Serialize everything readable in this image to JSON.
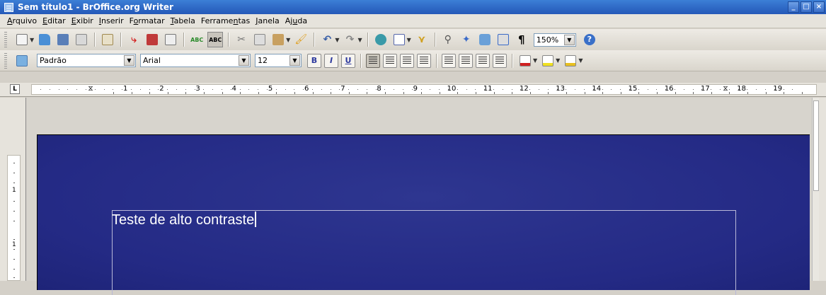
{
  "window": {
    "title": "Sem título1 - BrOffice.org Writer"
  },
  "menu": [
    {
      "u": "A",
      "rest": "rquivo"
    },
    {
      "u": "E",
      "rest": "ditar"
    },
    {
      "u": "E",
      "rest": "xibir",
      "pre": ""
    },
    {
      "u": "I",
      "rest": "nserir"
    },
    {
      "pre": "F",
      "u": "o",
      "rest": "rmatar"
    },
    {
      "u": "T",
      "rest": "abela"
    },
    {
      "pre": "Ferrame",
      "u": "n",
      "rest": "tas"
    },
    {
      "u": "J",
      "rest": "anela"
    },
    {
      "pre": "Aj",
      "u": "u",
      "rest": "da"
    }
  ],
  "standard_toolbar": {
    "zoom": "150%"
  },
  "formatting_toolbar": {
    "style": "Padrão",
    "font": "Arial",
    "size": "12",
    "bold": "B",
    "italic": "I",
    "underline": "U"
  },
  "ruler": {
    "corner": "L",
    "numbers": [
      "1",
      "2",
      "3",
      "4",
      "5",
      "6",
      "7",
      "8",
      "9",
      "10",
      "11",
      "12",
      "13",
      "14",
      "15",
      "16",
      "17",
      "18",
      "19"
    ]
  },
  "vruler": {
    "numbers": [
      "1",
      "1"
    ]
  },
  "document": {
    "text": "Teste de alto contraste"
  },
  "colors": {
    "page_background": "#242a85",
    "text": "#ffffff",
    "titlebar": "#2f68c8"
  }
}
